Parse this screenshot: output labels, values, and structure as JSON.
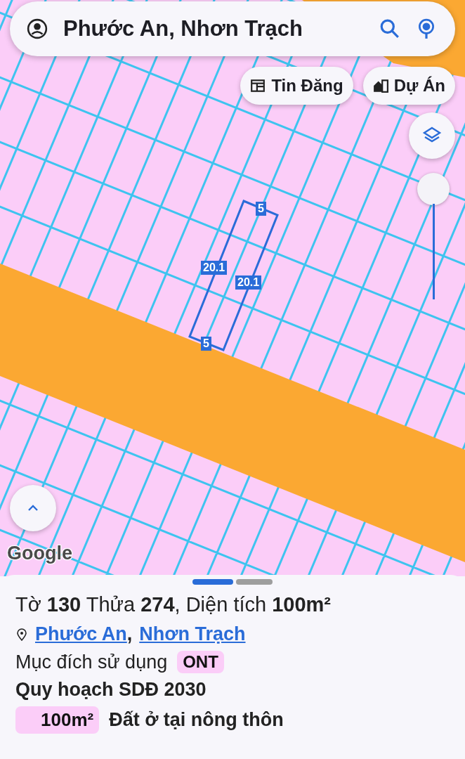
{
  "search_bar": {
    "query": "Phước An, Nhơn Trạch"
  },
  "map_buttons": [
    {
      "label": "Tin Đăng",
      "kind": "listing"
    },
    {
      "label": "Dự Án",
      "kind": "project"
    }
  ],
  "zoom_slider": {
    "level": 1
  },
  "parcel_labels": [
    "5",
    "20.1",
    "20.1",
    "5"
  ],
  "map_attribution": "Google",
  "sheet_pager": [
    {
      "selected": true
    },
    {
      "selected": false
    }
  ],
  "parcel_info": {
    "title": "Tờ **130** Thửa **274**, Diện tích **100m²**",
    "locations": [
      "Phước An",
      "Nhơn Trạch"
    ],
    "location_separator": ",",
    "purpose_label": "Mục đích sử dụng",
    "purpose_code": "ONT",
    "plan_title": "Quy hoạch SDĐ 2030",
    "plan_rows": [
      {
        "area": "100m²",
        "description": "Đất ở tại nông thôn"
      }
    ]
  }
}
